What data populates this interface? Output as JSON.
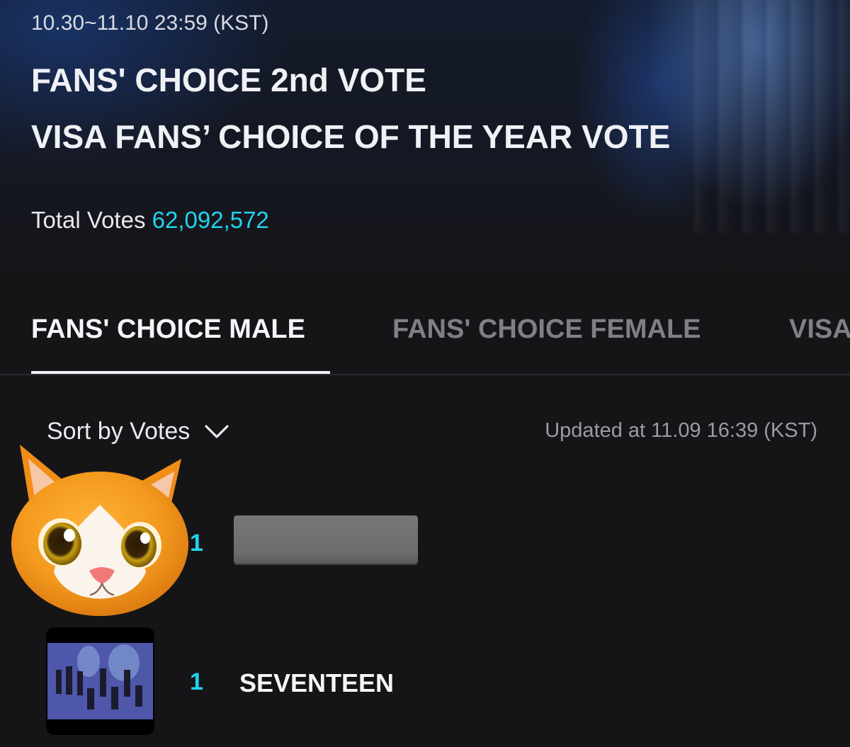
{
  "header": {
    "date_range": "10.30~11.10 23:59 (KST)",
    "title_line1": "FANS' CHOICE 2nd VOTE",
    "title_line2": "VISA FANS’ CHOICE OF THE YEAR VOTE",
    "total_label": "Total Votes",
    "total_value": "62,092,572"
  },
  "tabs": [
    {
      "label": "FANS' CHOICE MALE",
      "active": true
    },
    {
      "label": "FANS' CHOICE FEMALE",
      "active": false
    },
    {
      "label": "VISA",
      "active": false
    }
  ],
  "controls": {
    "sort_label": "Sort by Votes",
    "updated": "Updated at 11.09 16:39 (KST)"
  },
  "ranking": [
    {
      "rank": "1",
      "name": ""
    },
    {
      "rank": "1",
      "name": "SEVENTEEN"
    }
  ],
  "colors": {
    "accent": "#22d3ee",
    "background": "#151517",
    "inactive_tab": "#7e8088"
  },
  "icons": [
    "chevron-down-icon",
    "cat-emoji-sticker",
    "group-photo-thumbnail"
  ]
}
